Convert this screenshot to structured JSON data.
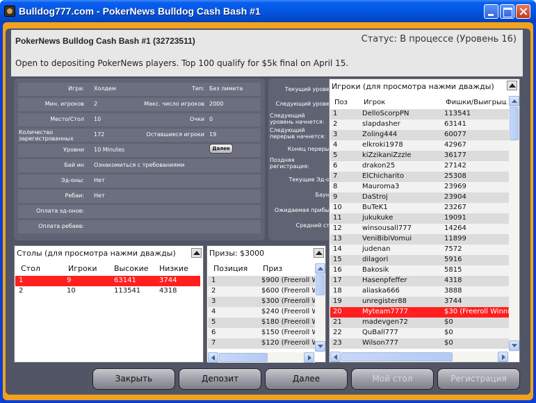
{
  "window": {
    "title": "Bulldog777.com - PokerNews Bulldog Cash Bash #1"
  },
  "header": {
    "title": "PokerNews Bulldog Cash Bash #1 (32723511)",
    "status": "Статус: В процессе (Уровень 16)",
    "description": "Open to depositing PokerNews players. Top 100 qualify for $5k final on April 15."
  },
  "info": {
    "game_label": "Игра:",
    "game_value": "Холдем",
    "type_label": "Тип:",
    "type_value": "Без лимита",
    "min_players_label": "Мин. игроков",
    "min_players_value": "2",
    "max_players_label": "Макс. число игроков",
    "max_players_value": "2000",
    "seats_label": "Место/Стол",
    "seats_value": "10",
    "points_label": "Очки",
    "points_value": "0",
    "registered_label": "Количество зарегистрованных",
    "registered_value": "172",
    "remaining_label": "Оставшиеся игроки",
    "remaining_value": "19",
    "levels_label": "Уровни",
    "levels_value": "10 Minutes",
    "more_button": "Далее",
    "buyin_label": "Бай ин",
    "buyin_value": "Ознакомиться с требованиями",
    "addons_label": "Эд-оны:",
    "addons_value": "Нет",
    "rebuys_label": "Ребаи:",
    "rebuys_value": "Нет",
    "addon_payment_label": "Оплата эд-онов:",
    "rebuy_payment_label": "Оплата ребаев:"
  },
  "info_right": {
    "current_level": "Текущий урове",
    "next_level": "Следующий урове",
    "next_level_starts": "Следующий уровень начнется:",
    "next_break": "Следующий перерыв начнется:",
    "break_end": "Конец переры",
    "late_reg": "Поздняя регистрация:",
    "current_addons": "Текущие Эд-о",
    "bounty": "Баун",
    "expected_profit": "Ожидаемая прибы",
    "average_stack": "Средний ст"
  },
  "tables_pane": {
    "title": "Столы (для просмотра нажми дважды)",
    "columns": [
      "Стол",
      "Игроки",
      "Высокие",
      "Низкие"
    ],
    "rows": [
      [
        "1",
        "9",
        "63141",
        "3744"
      ],
      [
        "2",
        "10",
        "113541",
        "4318"
      ]
    ]
  },
  "prizes_pane": {
    "title": "Призы: $3000",
    "columns": [
      "Позиция",
      "Приз"
    ],
    "rows": [
      [
        "1",
        "$900 (Freeroll W"
      ],
      [
        "2",
        "$600 (Freeroll W"
      ],
      [
        "3",
        "$300 (Freeroll W"
      ],
      [
        "4",
        "$240 (Freeroll W"
      ],
      [
        "5",
        "$180 (Freeroll W"
      ],
      [
        "6",
        "$150 (Freeroll W"
      ],
      [
        "7",
        "$120 (Freeroll W"
      ]
    ]
  },
  "players_pane": {
    "title": "Игроки (для просмотра нажми дважды)",
    "columns": [
      "Поз",
      "Игрок",
      "Фишки/Выигрыш"
    ],
    "rows": [
      [
        "1",
        "DelloScorpPN",
        "113541"
      ],
      [
        "2",
        "slapdasher",
        "63141"
      ],
      [
        "3",
        "Zoling444",
        "60077"
      ],
      [
        "4",
        "elkroki1978",
        "42967"
      ],
      [
        "5",
        "kiZzikaniZzzle",
        "36177"
      ],
      [
        "6",
        "drakon25",
        "27142"
      ],
      [
        "7",
        "ElChicharito",
        "25308"
      ],
      [
        "8",
        "Mauroma3",
        "23969"
      ],
      [
        "9",
        "DaStroj",
        "23904"
      ],
      [
        "10",
        "BuTeK1",
        "23267"
      ],
      [
        "11",
        "jukukuke",
        "19091"
      ],
      [
        "12",
        "winsousall777",
        "14264"
      ],
      [
        "13",
        "VeniBibiVomui",
        "11899"
      ],
      [
        "14",
        "judenan",
        "7572"
      ],
      [
        "15",
        "dilagori",
        "5916"
      ],
      [
        "16",
        "Bakosik",
        "5815"
      ],
      [
        "17",
        "Hasenpfeffer",
        "4318"
      ],
      [
        "18",
        "aliaska666",
        "3888"
      ],
      [
        "19",
        "unregister88",
        "3744"
      ],
      [
        "20",
        "Myteam7777",
        "$30 (Freeroll Winnin"
      ],
      [
        "21",
        "madevgen72",
        "$0"
      ],
      [
        "22",
        "QuBall777",
        "$0"
      ],
      [
        "23",
        "Wilson777",
        "$0"
      ]
    ],
    "highlight_row": 20
  },
  "buttons": {
    "close": "Закрыть",
    "deposit": "Депозит",
    "next": "Далее",
    "my_table": "Мой стол",
    "register": "Регистрация"
  },
  "colors": {
    "highlight": "#ff1f1f",
    "frame": "#f0a21e",
    "panel": "#525566"
  }
}
